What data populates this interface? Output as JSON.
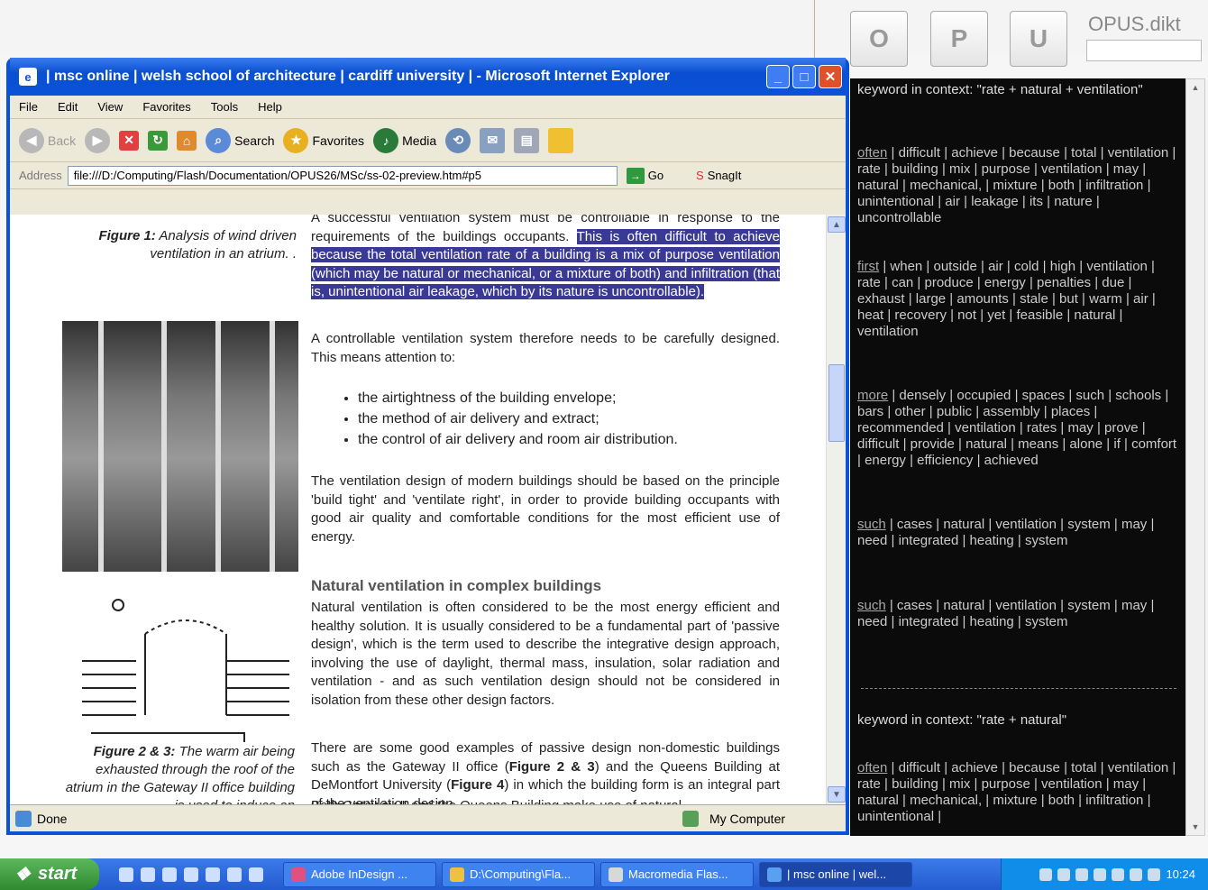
{
  "opus": {
    "buttons": [
      "O",
      "P",
      "U"
    ],
    "logo": "OPUS.dikt"
  },
  "window": {
    "title": "| msc online | welsh school of architecture | cardiff university | - Microsoft Internet Explorer",
    "menu": [
      "File",
      "Edit",
      "View",
      "Favorites",
      "Tools",
      "Help"
    ],
    "toolbar": {
      "back": "Back",
      "search": "Search",
      "favorites": "Favorites",
      "media": "Media"
    },
    "address_label": "Address",
    "address": "file:///D:/Computing/Flash/Documentation/OPUS26/MSc/ss-02-preview.htm#p5",
    "go": "Go",
    "snagit": "SnagIt",
    "status": "Done",
    "zone": "My Computer"
  },
  "page": {
    "figure1_caption_label": "Figure 1:",
    "figure1_caption": "Analysis of wind driven ventilation in an atrium. .",
    "figure23_caption_label": "Figure 2 & 3:",
    "figure23_caption": "The warm air being exhausted through the roof of the atrium in the Gateway II office building is used to induce an",
    "p1_start": "A successful ventilation system must be controllable in response to the requirements of the buildings occupants.",
    "p1_highlight": "This is often difficult to achieve because the total ventilation rate of a building is a mix of purpose ventilation (which may be natural or mechanical, or a mixture of both) and infiltration (that is, unintentional air leakage, which by its nature is uncontrollable).",
    "p2": "A controllable ventilation system therefore needs to be carefully designed. This means attention to:",
    "bullets": [
      "the airtightness of the building envelope;",
      "the method of air delivery and extract;",
      "the control of air delivery and room air distribution."
    ],
    "p3": "The ventilation design of modern buildings should be based on the principle 'build tight' and 'ventilate right', in order to provide building occupants with good air quality and comfortable conditions for the most efficient use of energy.",
    "heading": "Natural ventilation in complex buildings",
    "p4": "Natural ventilation is often considered to be the most energy efficient and healthy solution. It is usually considered to be a fundamental part of 'passive design', which is the term used to describe the integrative design approach, involving the use of daylight, thermal mass, insulation, solar radiation and ventilation - and as such ventilation design should not be considered in isolation from these other design factors.",
    "p5_a": "There are some good examples of passive design non-domestic buildings such as the Gateway II office (",
    "p5_fig23": "Figure 2 & 3",
    "p5_b": ") and the Queens Building at DeMontfort University (",
    "p5_fig4": "Figure 4",
    "p5_c": ") in which the building form is an integral part of the ventilation design.",
    "p6_partial": "Both Gateway II and the Queens Building make use of natural"
  },
  "panel": {
    "title1": "keyword in context: \"rate + natural + ventilation\"",
    "entries1": [
      {
        "kw": "often",
        "rest": " | difficult | achieve | because | total | ventilation | rate | building | mix | purpose | ventilation | may | natural | mechanical, | mixture | both | infiltration | unintentional | air | leakage | its | nature | uncontrollable"
      },
      {
        "kw": "first",
        "rest": " | when | outside | air | cold | high | ventilation | rate | can | produce | energy | penalties | due | exhaust | large | amounts | stale | but | warm | air | heat | recovery | not | yet | feasible | natural | ventilation"
      },
      {
        "kw": "more",
        "rest": " | densely | occupied | spaces | such | schools | bars | other | public | assembly | places | recommended | ventilation | rates | may | prove | difficult | provide | natural | means | alone | if | comfort | energy | efficiency | achieved"
      },
      {
        "kw": "such",
        "rest": " | cases | natural | ventilation | system | may | need | integrated | heating | system"
      },
      {
        "kw": "such",
        "rest": " | cases | natural | ventilation | system | may | need | integrated | heating | system"
      }
    ],
    "title2": "keyword in context: \"rate + natural\"",
    "entries2": [
      {
        "kw": "often",
        "rest": " | difficult | achieve | because | total | ventilation | rate | building | mix | purpose | ventilation | may | natural | mechanical, | mixture | both | infiltration | unintentional |"
      }
    ]
  },
  "taskbar": {
    "start": "start",
    "tasks": [
      "Adobe InDesign ...",
      "D:\\Computing\\Fla...",
      "Macromedia Flas...",
      "| msc online | wel..."
    ],
    "clock": "10:24"
  }
}
